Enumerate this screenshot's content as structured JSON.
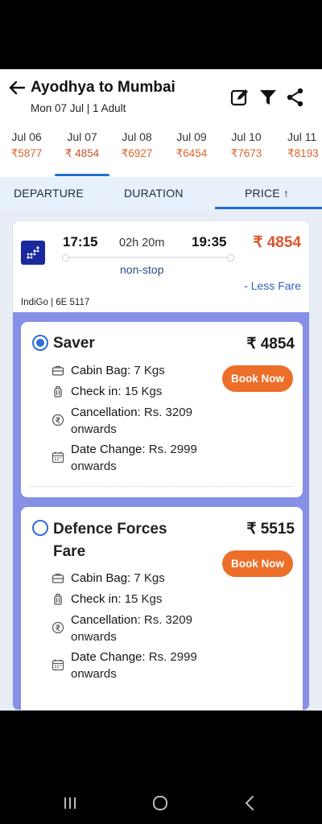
{
  "header": {
    "title": "Ayodhya to Mumbai",
    "subtitle": "Mon 07 Jul | 1 Adult",
    "icons": [
      "arrow-left-icon",
      "edit-icon",
      "filter-icon",
      "share-icon"
    ]
  },
  "dates": [
    {
      "date": "Jul 06",
      "price": "₹5877"
    },
    {
      "date": "Jul 07",
      "price": "₹ 4854"
    },
    {
      "date": "Jul 08",
      "price": "₹6927"
    },
    {
      "date": "Jul 09",
      "price": "₹6454"
    },
    {
      "date": "Jul 10",
      "price": "₹7673"
    },
    {
      "date": "Jul 11",
      "price": "₹8193"
    }
  ],
  "sort": {
    "departure": "DEPARTURE",
    "duration": "DURATION",
    "price": "PRICE ↑"
  },
  "flight": {
    "dep_time": "17:15",
    "duration": "02h 20m",
    "arr_time": "19:35",
    "price": "₹ 4854",
    "stops": "non-stop",
    "tag": "- Less Fare",
    "airline": "IndiGo | 6E 5117"
  },
  "fares": [
    {
      "name": "Saver",
      "price": "₹ 4854",
      "book_label": "Book Now",
      "cabin_label": "Cabin Bag:",
      "cabin_value": "7 Kgs",
      "checkin_label": "Check in:",
      "checkin_value": "15 Kgs",
      "cancel_label": "Cancellation:",
      "cancel_value": "Rs. 3209 onwards",
      "change_label": "Date Change:",
      "change_value": "Rs. 2999 onwards"
    },
    {
      "name": "Defence Forces Fare",
      "price": "₹ 5515",
      "book_label": "Book Now",
      "cabin_label": "Cabin Bag:",
      "cabin_value": "7 Kgs",
      "checkin_label": "Check in:",
      "checkin_value": "15 Kgs",
      "cancel_label": "Cancellation:",
      "cancel_value": "Rs. 3209 onwards",
      "change_label": "Date Change:",
      "change_value": "Rs. 2999 onwards"
    }
  ],
  "colors": {
    "accent": "#1e6fd0",
    "price": "#d9562b",
    "book_button": "#ec6e28",
    "fares_panel": "#8590e6"
  }
}
